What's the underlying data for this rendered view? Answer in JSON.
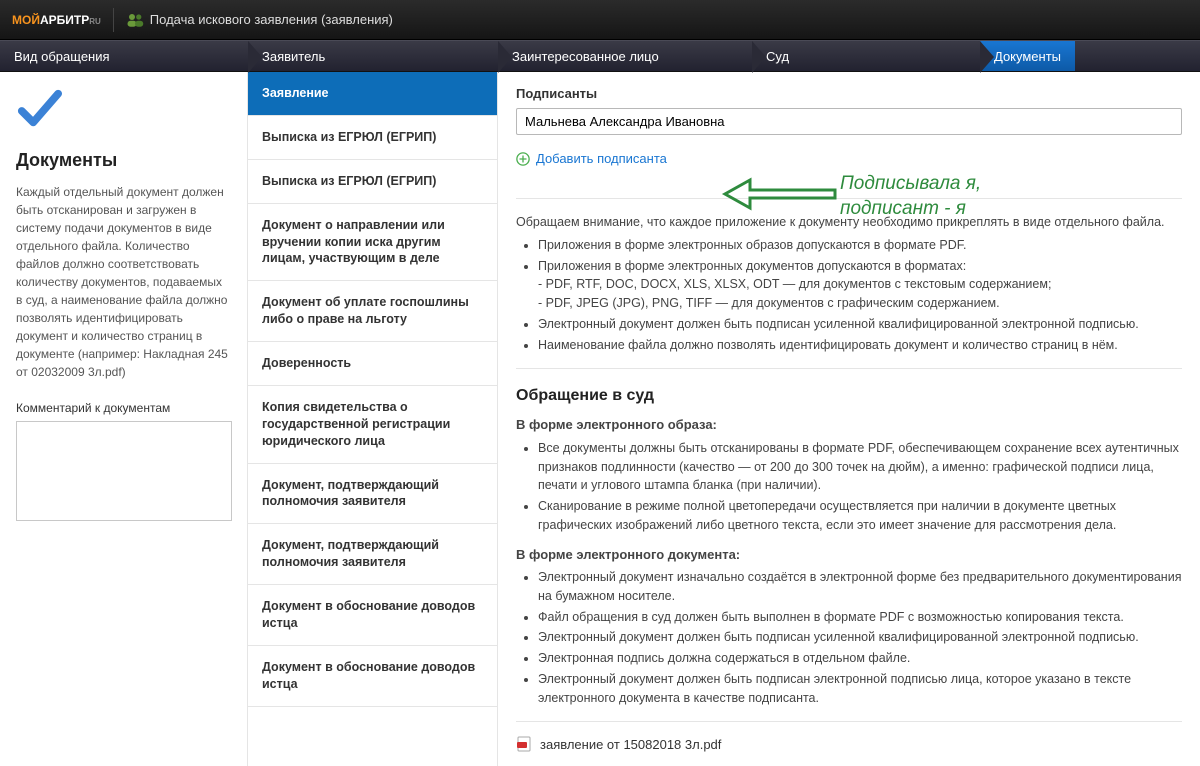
{
  "header": {
    "logo_part1": "МОЙ",
    "logo_part2": "АРБИТР",
    "logo_ru": "RU",
    "title": "Подача искового заявления (заявления)"
  },
  "steps": [
    "Вид обращения",
    "Заявитель",
    "Заинтересованное лицо",
    "Суд",
    "Документы"
  ],
  "left": {
    "title": "Документы",
    "desc": "Каждый отдельный документ должен быть отсканирован и загружен в систему подачи документов в виде отдельного файла. Количество файлов должно соответствовать количеству документов, подаваемых в суд, а наименование файла должно позволять идентифицировать документ и количество страниц в документе (например: Накладная 245 от 02032009 3л.pdf)",
    "comment_label": "Комментарий к документам"
  },
  "docs": [
    "Заявление",
    "Выписка из ЕГРЮЛ (ЕГРИП)",
    "Выписка из ЕГРЮЛ (ЕГРИП)",
    "Документ о направлении или вручении копии иска другим лицам, участвующим в деле",
    "Документ об уплате госпошлины либо о праве на льготу",
    "Доверенность",
    "Копия свидетельства о государственной регистрации юридического лица",
    "Документ, подтверждающий полномочия заявителя",
    "Документ, подтверждающий полномочия заявителя",
    "Документ в обоснование доводов истца",
    "Документ в обоснование доводов истца"
  ],
  "right": {
    "signers_label": "Подписанты",
    "signer_value": "Мальнева Александра Ивановна",
    "add_signer": "Добавить подписанта",
    "notice_intro": "Обращаем внимание, что каждое приложение к документу необходимо прикреплять в виде отдельного файла.",
    "notice_items": [
      "Приложения в форме электронных образов допускаются в формате PDF.",
      "Приложения в форме электронных документов допускаются в форматах:",
      "- PDF, RTF, DOC, DOCX, XLS, XLSX, ODT — для документов с текстовым содержанием;",
      "- PDF, JPEG (JPG), PNG, TIFF — для документов с графическим содержанием.",
      "Электронный документ должен быть подписан усиленной квалифицированной электронной подписью.",
      "Наименование файла должно позволять идентифицировать документ и количество страниц в нём."
    ],
    "appeal_title": "Обращение в суд",
    "form1_title": "В форме электронного образа:",
    "form1_items": [
      "Все документы должны быть отсканированы в формате PDF, обеспечивающем сохранение всех аутентичных признаков подлинности (качество — от 200 до 300 точек на дюйм), а именно: графической подписи лица, печати и углового штампа бланка (при наличии).",
      "Сканирование в режиме полной цветопередачи осуществляется при наличии в документе цветных графических изображений либо цветного текста, если это имеет значение для рассмотрения дела."
    ],
    "form2_title": "В форме электронного документа:",
    "form2_items": [
      "Электронный документ изначально создаётся в электронной форме без предварительного документирования на бумажном носителе.",
      "Файл обращения в суд должен быть выполнен в формате PDF с возможностью копирования текста.",
      "Электронный документ должен быть подписан усиленной квалифицированной электронной подписью.",
      "Электронная подпись должна содержаться в отдельном файле.",
      "Электронный документ должен быть подписан электронной подписью лица, которое указано в тексте электронного документа в качестве подписанта."
    ],
    "file_name": "заявление от 15082018 3л.pdf"
  },
  "annotation": {
    "line1": "Подписывала я,",
    "line2": "подписант - я"
  }
}
